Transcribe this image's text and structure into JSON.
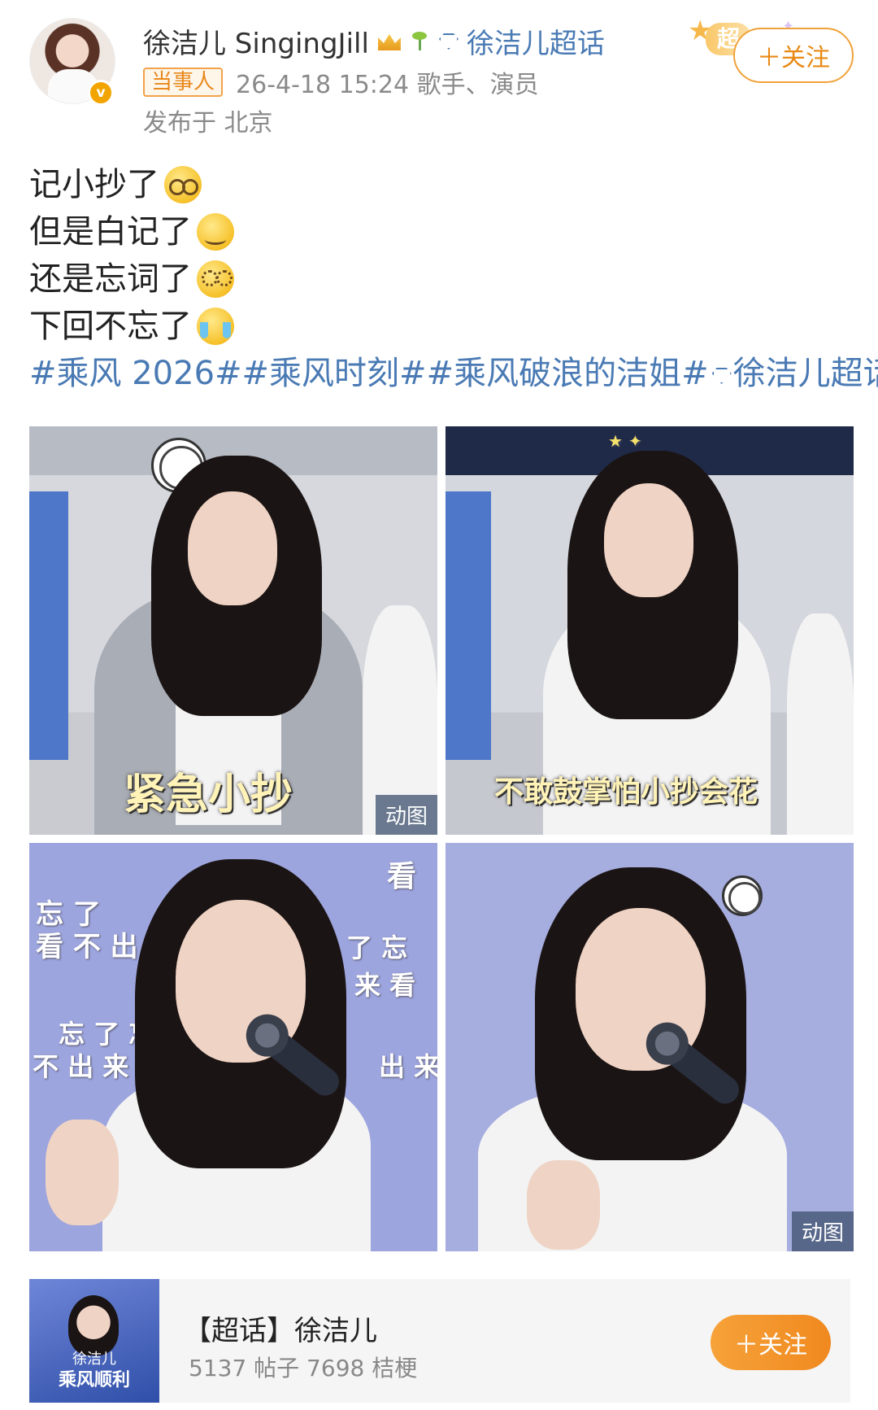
{
  "header": {
    "username": "徐洁儿 SingingJill",
    "topic_link": "徐洁儿超话",
    "super_badge": "超",
    "follow_label": "＋关注",
    "party_badge": "当事人",
    "meta": "26-4-18 15:24  歌手、演员",
    "location": "发布于 北京"
  },
  "post": {
    "lines": [
      "记小抄了",
      "但是白记了",
      "还是忘词了",
      "下回不忘了"
    ],
    "hashtags": "#乘风 2026##乘风时刻##乘风破浪的洁姐#",
    "hashtag_topic": "徐洁儿超话"
  },
  "images": [
    {
      "caption": "紧急小抄",
      "badge": "动图"
    },
    {
      "caption": "不敢鼓掌怕小抄会花"
    },
    {
      "overlay": [
        "忘 了",
        "看 不 出 来",
        "忘 了 忘",
        "不 出 来 看",
        "看",
        "了 忘",
        "来 看",
        "出 来"
      ]
    },
    {
      "badge": "动图"
    }
  ],
  "topic_card": {
    "title": "【超话】徐洁儿",
    "stats": "5137 帖子 7698 桔梗",
    "follow_label": "＋关注",
    "cover_name": "徐洁儿",
    "cover_text": "乘风顺利"
  },
  "colors": {
    "link": "#4a7ab4",
    "accent": "#f0891f",
    "meta": "#8a8a8a"
  }
}
